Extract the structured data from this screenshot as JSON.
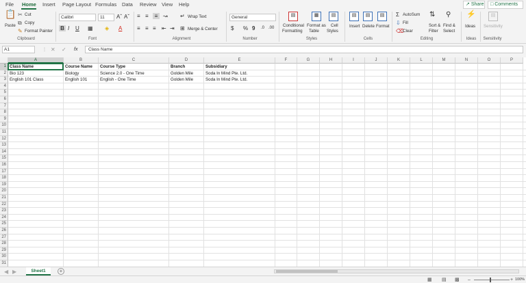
{
  "menu": {
    "items": [
      "File",
      "Home",
      "Insert",
      "Page Layout",
      "Formulas",
      "Data",
      "Review",
      "View",
      "Help"
    ],
    "share_label": "Share",
    "comments_label": "Comments"
  },
  "ribbon": {
    "clipboard": {
      "paste": "Paste",
      "cut": "Cut",
      "copy": "Copy",
      "format_painter": "Format Painter",
      "label": "Clipboard"
    },
    "font": {
      "name": "Calibri",
      "size": "11",
      "label": "Font"
    },
    "alignment": {
      "wrap_text": "Wrap Text",
      "merge_center": "Merge & Center",
      "label": "Alignment"
    },
    "number": {
      "format": "General",
      "label": "Number"
    },
    "styles": {
      "conditional": "Conditional",
      "conditional2": "Formatting",
      "format_as": "Format as",
      "table": "Table",
      "cell": "Cell",
      "styles_word": "Styles",
      "label": "Styles"
    },
    "cells": {
      "insert": "Insert",
      "delete": "Delete",
      "format": "Format",
      "label": "Cells"
    },
    "editing": {
      "autosum": "AutoSum",
      "fill": "Fill",
      "clear": "Clear",
      "sort": "Sort &",
      "filter": "Filter",
      "find": "Find &",
      "select": "Select",
      "label": "Editing"
    },
    "ideas": {
      "button": "Ideas",
      "label": "Ideas"
    },
    "sensitivity": {
      "button": "Sensitivity",
      "label": "Sensitivity"
    }
  },
  "formula_bar": {
    "name_box": "A1",
    "fx": "fx",
    "content": "Class Name"
  },
  "grid": {
    "columns": [
      "A",
      "B",
      "C",
      "D",
      "E",
      "F",
      "G",
      "H",
      "I",
      "J",
      "K",
      "L",
      "M",
      "N",
      "O",
      "P"
    ],
    "rows": [
      "1",
      "2",
      "3",
      "4",
      "5",
      "6",
      "7",
      "8",
      "9",
      "10",
      "11",
      "12",
      "13",
      "14",
      "15",
      "16",
      "17",
      "18",
      "19",
      "20",
      "21",
      "22",
      "23",
      "24",
      "25",
      "26",
      "27",
      "28",
      "29",
      "30",
      "31"
    ],
    "data": [
      [
        "Class Name",
        "Course Name",
        "Course Type",
        "Branch",
        "Subsidiary"
      ],
      [
        "Bio 123",
        "Biology",
        "Science 2.0 - One Time",
        "Golden Mile",
        "Soda In Mind Pte. Ltd."
      ],
      [
        "English 101 Class",
        "English 101",
        "English - One Time",
        "Golden Mile",
        "Soda In Mind Pte. Ltd."
      ]
    ]
  },
  "sheets": {
    "active": "Sheet1"
  },
  "status": {
    "zoom": "100%"
  },
  "colors": {
    "accent": "#217346"
  }
}
